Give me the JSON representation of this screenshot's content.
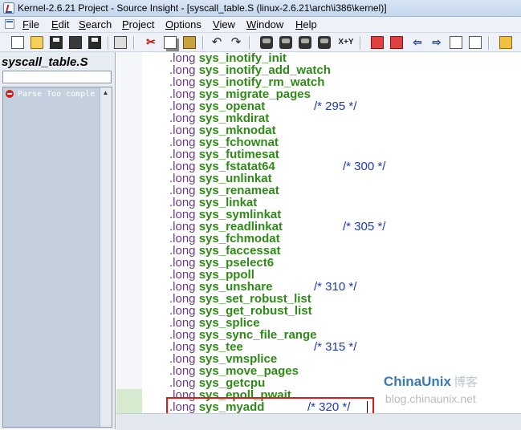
{
  "window": {
    "title": "Kernel-2.6.21 Project - Source Insight - [syscall_table.S (linux-2.6.21\\arch\\i386\\kernel)]"
  },
  "menubar": {
    "items": [
      {
        "label": "File",
        "u": "F",
        "rest": "ile"
      },
      {
        "label": "Edit",
        "u": "E",
        "rest": "dit"
      },
      {
        "label": "Search",
        "u": "S",
        "rest": "earch"
      },
      {
        "label": "Project",
        "u": "P",
        "rest": "roject"
      },
      {
        "label": "Options",
        "u": "O",
        "rest": "ptions"
      },
      {
        "label": "View",
        "u": "V",
        "rest": "iew"
      },
      {
        "label": "Window",
        "u": "W",
        "rest": "indow"
      },
      {
        "label": "Help",
        "u": "H",
        "rest": "elp"
      }
    ]
  },
  "toolbar": {
    "icons": [
      "new-file-icon",
      "open-folder-icon",
      "save-icon",
      "save-all-icon",
      "close-file-icon",
      "print-icon",
      "cut-icon",
      "copy-icon",
      "paste-icon",
      "undo-icon",
      "redo-icon",
      "find-icon",
      "find-next-icon",
      "find-prev-icon",
      "find-all-icon",
      "replace-icon",
      "bookmark-prev-icon",
      "bookmark-next-icon",
      "back-icon",
      "forward-icon",
      "indent-left-icon",
      "indent-right-icon",
      "lock-icon"
    ],
    "xy_label": "X+Y"
  },
  "sidebar": {
    "file_name": "syscall_table.S",
    "search_value": "",
    "symbol_items": [
      {
        "icon": "error-icon",
        "text": "Parse Too comple"
      }
    ]
  },
  "editor": {
    "lines": [
      {
        "prefix": ".long",
        "name": "sys_inotify_init",
        "comment": ""
      },
      {
        "prefix": ".long",
        "name": "sys_inotify_add_watch",
        "comment": ""
      },
      {
        "prefix": ".long",
        "name": "sys_inotify_rm_watch",
        "comment": ""
      },
      {
        "prefix": ".long",
        "name": "sys_migrate_pages",
        "comment": ""
      },
      {
        "prefix": ".long",
        "name": "sys_openat",
        "comment": "/* 295 */"
      },
      {
        "prefix": ".long",
        "name": "sys_mkdirat",
        "comment": ""
      },
      {
        "prefix": ".long",
        "name": "sys_mknodat",
        "comment": ""
      },
      {
        "prefix": ".long",
        "name": "sys_fchownat",
        "comment": ""
      },
      {
        "prefix": ".long",
        "name": "sys_futimesat",
        "comment": ""
      },
      {
        "prefix": ".long",
        "name": "sys_fstatat64",
        "comment": "/* 300 */"
      },
      {
        "prefix": ".long",
        "name": "sys_unlinkat",
        "comment": ""
      },
      {
        "prefix": ".long",
        "name": "sys_renameat",
        "comment": ""
      },
      {
        "prefix": ".long",
        "name": "sys_linkat",
        "comment": ""
      },
      {
        "prefix": ".long",
        "name": "sys_symlinkat",
        "comment": ""
      },
      {
        "prefix": ".long",
        "name": "sys_readlinkat",
        "comment": "/* 305 */"
      },
      {
        "prefix": ".long",
        "name": "sys_fchmodat",
        "comment": ""
      },
      {
        "prefix": ".long",
        "name": "sys_faccessat",
        "comment": ""
      },
      {
        "prefix": ".long",
        "name": "sys_pselect6",
        "comment": ""
      },
      {
        "prefix": ".long",
        "name": "sys_ppoll",
        "comment": ""
      },
      {
        "prefix": ".long",
        "name": "sys_unshare",
        "comment": "/* 310 */"
      },
      {
        "prefix": ".long",
        "name": "sys_set_robust_list",
        "comment": ""
      },
      {
        "prefix": ".long",
        "name": "sys_get_robust_list",
        "comment": ""
      },
      {
        "prefix": ".long",
        "name": "sys_splice",
        "comment": ""
      },
      {
        "prefix": ".long",
        "name": "sys_sync_file_range",
        "comment": ""
      },
      {
        "prefix": ".long",
        "name": "sys_tee",
        "comment": "/* 315 */"
      },
      {
        "prefix": ".long",
        "name": "sys_vmsplice",
        "comment": ""
      },
      {
        "prefix": ".long",
        "name": "sys_move_pages",
        "comment": ""
      },
      {
        "prefix": ".long",
        "name": "sys_getcpu",
        "comment": ""
      },
      {
        "prefix": ".long",
        "name": "sys_epoll_pwait",
        "comment": ""
      },
      {
        "prefix": ".long",
        "name": "sys_myadd",
        "comment": "/* 320 */"
      }
    ]
  },
  "watermark": {
    "brand": "ChinaUnix",
    "brand_cn": "博客",
    "url": "blog.chinaunix.net"
  },
  "colors": {
    "keyword": "#6a3a80",
    "function_name": "#2e8a16",
    "comment": "#1b3ab0",
    "highlight_box": "#e01818"
  }
}
